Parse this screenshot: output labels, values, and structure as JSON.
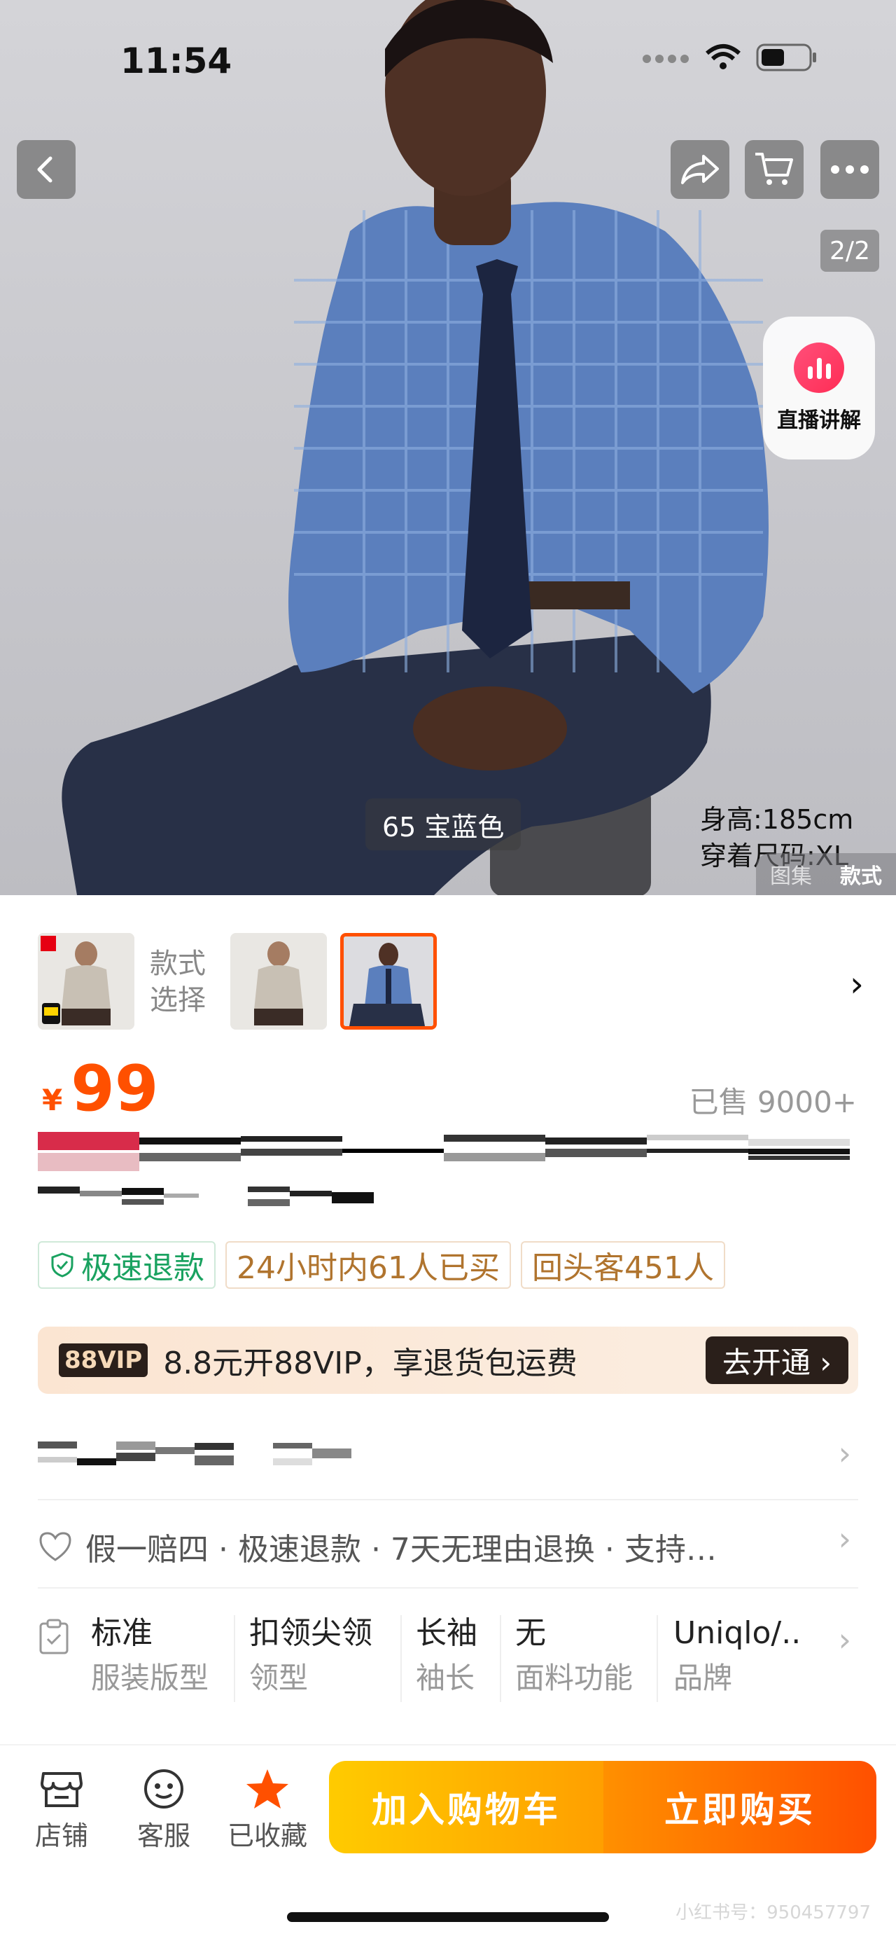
{
  "status_bar": {
    "time": "11:54"
  },
  "hero": {
    "page_indicator": "2/2",
    "live_label": "直播讲解",
    "color_chip": "65 宝蓝色",
    "model_height": "身高:185cm",
    "model_size": "穿着尺码:XL",
    "tabs": [
      "图集",
      "款式"
    ]
  },
  "style_selector": {
    "label_line1": "款式",
    "label_line2": "选择"
  },
  "price": {
    "symbol": "¥",
    "value": "99",
    "sold": "已售 9000+"
  },
  "tags": {
    "refund": "极速退款",
    "bought": "24小时内61人已买",
    "repeat": "回头客451人"
  },
  "vip": {
    "badge": "88VIP",
    "text": "8.8元开88VIP，享退货包运费",
    "button": "去开通 ›"
  },
  "guarantee": {
    "text": "假一赔四 · 极速退款 · 7天无理由退换 · 支持…"
  },
  "specs": [
    {
      "value": "标准",
      "key": "服装版型"
    },
    {
      "value": "扣领尖领",
      "key": "领型"
    },
    {
      "value": "长袖",
      "key": "袖长"
    },
    {
      "value": "无",
      "key": "面料功能"
    },
    {
      "value": "Uniqlo/..",
      "key": "品牌"
    }
  ],
  "bottom_bar": {
    "store": "店铺",
    "service": "客服",
    "favorited": "已收藏",
    "add_to_cart": "加入购物车",
    "buy_now": "立即购买"
  },
  "watermark": "小红书号：950457797",
  "colors": {
    "accent": "#ff5000",
    "cart_yellow": "#ffb300",
    "refund_green": "#1aa260"
  },
  "icons": [
    "back-icon",
    "share-icon",
    "cart-icon",
    "more-icon",
    "live-icon",
    "heart-icon",
    "clipboard-icon",
    "store-icon",
    "service-icon",
    "star-icon",
    "chevron-right-icon"
  ]
}
